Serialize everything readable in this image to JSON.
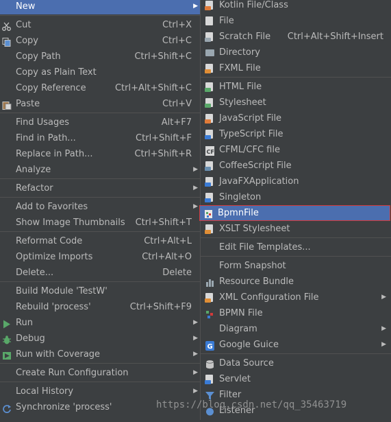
{
  "left_menu": {
    "items": [
      {
        "label": "New",
        "shortcut": "",
        "submenu": true,
        "selected": true,
        "icon": ""
      },
      {
        "label": "Cut",
        "shortcut": "Ctrl+X",
        "icon": "scissors-icon"
      },
      {
        "label": "Copy",
        "shortcut": "Ctrl+C",
        "icon": "copy-icon"
      },
      {
        "label": "Copy Path",
        "shortcut": "Ctrl+Shift+C",
        "icon": ""
      },
      {
        "label": "Copy as Plain Text",
        "shortcut": "",
        "icon": ""
      },
      {
        "label": "Copy Reference",
        "shortcut": "Ctrl+Alt+Shift+C",
        "icon": ""
      },
      {
        "label": "Paste",
        "shortcut": "Ctrl+V",
        "icon": "paste-icon"
      },
      {
        "label": "Find Usages",
        "shortcut": "Alt+F7",
        "icon": ""
      },
      {
        "label": "Find in Path...",
        "shortcut": "Ctrl+Shift+F",
        "icon": ""
      },
      {
        "label": "Replace in Path...",
        "shortcut": "Ctrl+Shift+R",
        "icon": ""
      },
      {
        "label": "Analyze",
        "shortcut": "",
        "submenu": true,
        "icon": ""
      },
      {
        "label": "Refactor",
        "shortcut": "",
        "submenu": true,
        "icon": ""
      },
      {
        "label": "Add to Favorites",
        "shortcut": "",
        "submenu": true,
        "icon": ""
      },
      {
        "label": "Show Image Thumbnails",
        "shortcut": "Ctrl+Shift+T",
        "icon": ""
      },
      {
        "label": "Reformat Code",
        "shortcut": "Ctrl+Alt+L",
        "icon": ""
      },
      {
        "label": "Optimize Imports",
        "shortcut": "Ctrl+Alt+O",
        "icon": ""
      },
      {
        "label": "Delete...",
        "shortcut": "Delete",
        "icon": ""
      },
      {
        "label": "Build Module 'TestW'",
        "shortcut": "",
        "icon": ""
      },
      {
        "label": "Rebuild 'process'",
        "shortcut": "Ctrl+Shift+F9",
        "icon": ""
      },
      {
        "label": "Run",
        "shortcut": "",
        "submenu": true,
        "icon": "run-icon"
      },
      {
        "label": "Debug",
        "shortcut": "",
        "submenu": true,
        "icon": "debug-icon"
      },
      {
        "label": "Run with Coverage",
        "shortcut": "",
        "submenu": true,
        "icon": "coverage-icon"
      },
      {
        "label": "Create Run Configuration",
        "shortcut": "",
        "submenu": true,
        "icon": ""
      },
      {
        "label": "Local History",
        "shortcut": "",
        "submenu": true,
        "icon": ""
      },
      {
        "label": "Synchronize 'process'",
        "shortcut": "",
        "icon": "sync-icon"
      }
    ]
  },
  "right_menu": {
    "items": [
      {
        "label": "Kotlin File/Class",
        "submenu": false,
        "icon": "kotlin-file-icon"
      },
      {
        "label": "File",
        "icon": "file-icon"
      },
      {
        "label": "Scratch File",
        "shortcut": "Ctrl+Alt+Shift+Insert",
        "icon": "scratch-file-icon"
      },
      {
        "label": "Directory",
        "icon": "folder-icon"
      },
      {
        "label": "FXML File",
        "icon": "fxml-file-icon"
      },
      {
        "label": "HTML File",
        "icon": "html-file-icon"
      },
      {
        "label": "Stylesheet",
        "icon": "css-file-icon"
      },
      {
        "label": "JavaScript File",
        "icon": "javascript-file-icon"
      },
      {
        "label": "TypeScript File",
        "icon": "typescript-file-icon"
      },
      {
        "label": "CFML/CFC file",
        "icon": "cfml-file-icon"
      },
      {
        "label": "CoffeeScript File",
        "icon": "coffeescript-file-icon"
      },
      {
        "label": "JavaFXApplication",
        "icon": "javafx-file-icon"
      },
      {
        "label": "Singleton",
        "icon": "singleton-file-icon"
      },
      {
        "label": "BpmnFile",
        "icon": "bpmn-file-icon",
        "selected": true,
        "highlighted": true
      },
      {
        "label": "XSLT Stylesheet",
        "icon": "xslt-file-icon"
      },
      {
        "label": "Edit File Templates...",
        "icon": ""
      },
      {
        "label": "Form Snapshot",
        "icon": ""
      },
      {
        "label": "Resource Bundle",
        "icon": "resource-bundle-icon"
      },
      {
        "label": "XML Configuration File",
        "submenu": true,
        "icon": "xml-config-icon"
      },
      {
        "label": "BPMN File",
        "icon": "bpmn-diagram-icon"
      },
      {
        "label": "Diagram",
        "submenu": true,
        "icon": ""
      },
      {
        "label": "Google Guice",
        "submenu": true,
        "icon": "guice-icon"
      },
      {
        "label": "Data Source",
        "icon": "data-source-icon"
      },
      {
        "label": "Servlet",
        "icon": "servlet-icon"
      },
      {
        "label": "Filter",
        "icon": "filter-icon"
      },
      {
        "label": "Listener",
        "icon": "listener-icon"
      }
    ]
  },
  "watermark": "https://blog.csdn.net/qq_35463719",
  "colors": {
    "background": "#3c3f41",
    "selection": "#4b6eaf",
    "highlight_border": "#d13a3a",
    "text": "#bbbbbb"
  }
}
